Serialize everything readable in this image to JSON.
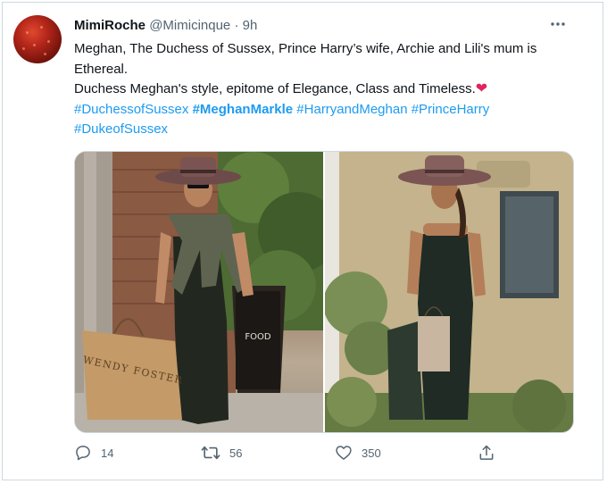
{
  "tweet": {
    "display_name": "MimiRoche",
    "handle": "@Mimicinque",
    "separator": "·",
    "time": "9h",
    "more_icon": "more-horizontal-icon",
    "line1": "Meghan, The Duchess of Sussex, Prince Harry’s wife, Archie and Lili's mum is Ethereal.",
    "line2": "Duchess Meghan's style, epitome of Elegance, Class and Timeless.",
    "heart": "❤",
    "hashtags": [
      "#DuchessofSussex",
      "#MeghanMarkle",
      "#HarryandMeghan",
      "#PrinceHarry",
      "#DukeofSussex"
    ]
  },
  "media": {
    "bag_text": "WENDY FOSTER",
    "sign_text": "FOOD"
  },
  "actions": {
    "reply_count": "14",
    "retweet_count": "56",
    "like_count": "350"
  },
  "colors": {
    "accent": "#1d9bf0",
    "text": "#0f1419",
    "muted": "#536471",
    "heart": "#e0245e"
  }
}
